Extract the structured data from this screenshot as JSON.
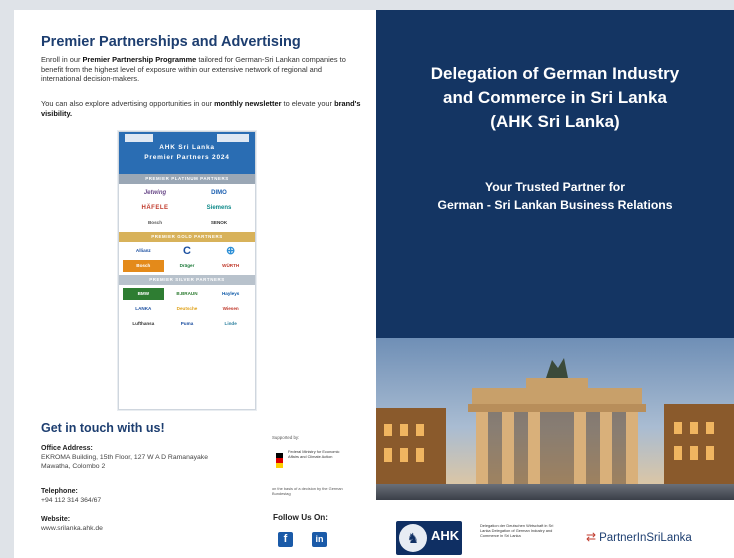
{
  "left": {
    "heading": "Premier Partnerships and Advertising",
    "para1_pre": "Enroll in our ",
    "para1_bold": "Premier Partnership Programme",
    "para1_post": " tailored for German-Sri Lankan companies to benefit from the highest level of exposure within our extensive network of regional and international decision-makers.",
    "para2_pre": "You can also explore advertising opportunities in our ",
    "para2_bold1": "monthly newsletter",
    "para2_mid": " to elevate your ",
    "para2_bold2": "brand's visibility.",
    "poster": {
      "title1": "AHK Sri Lanka",
      "title2": "Premier Partners 2024",
      "platinum_label": "PREMIER PLATINUM PARTNERS",
      "platinum_logos": [
        "Jetwing",
        "DIMO",
        "HÄFELE",
        "Siemens",
        "Bosch",
        "SENOK"
      ],
      "gold_label": "PREMIER GOLD PARTNERS",
      "gold_logos": [
        "Allianz",
        "C",
        "⊕",
        "Bosch",
        "Dräger",
        "WÜRTH"
      ],
      "silver_label": "PREMIER SILVER PARTNERS",
      "silver_logos": [
        "BMW",
        "B.BRAUN",
        "Hayleys",
        "LANKA",
        "Deutsche",
        "Wiesen",
        "Lufthansa",
        "Puma",
        "Linde"
      ]
    },
    "contact_heading": "Get in touch with us!",
    "office_label": "Office Address:",
    "office_value": "EKROMA Building, 15th Floor, 127 W A D Ramanayake Mawatha, Colombo 2",
    "phone_label": "Telephone:",
    "phone_value": "+94 112 314 364/67",
    "web_label": "Website:",
    "web_value": "www.srilanka.ahk.de",
    "supported_by": "Supported by:",
    "ministry": "Federal Ministry for Economic Affairs and Climate Action",
    "decision": "on the basis of a decision by the German Bundestag",
    "follow": "Follow Us On:",
    "social": [
      {
        "icon": "facebook-icon",
        "glyph": "f"
      },
      {
        "icon": "linkedin-icon",
        "glyph": "in"
      }
    ]
  },
  "right": {
    "title": "Delegation of German Industry and Commerce in Sri Lanka (AHK Sri Lanka)",
    "title_l1": "Delegation of German Industry",
    "title_l2": "and Commerce in Sri Lanka",
    "title_l3": "(AHK Sri Lanka)",
    "tagline_l1": "Your Trusted Partner for",
    "tagline_l2": "German - Sri Lankan Business Relations",
    "ahk_logo_text": "AHK",
    "ahk_sub": "Delegation der Deutschen Wirtschaft in Sri Lanka Delegation of German Industry and Commerce in Sri Lanka",
    "partner_logo": "PartnerInSriLanka"
  },
  "colors": {
    "navy": "#143563",
    "heading": "#1d3e70",
    "link_blue": "#1a5aa8"
  }
}
